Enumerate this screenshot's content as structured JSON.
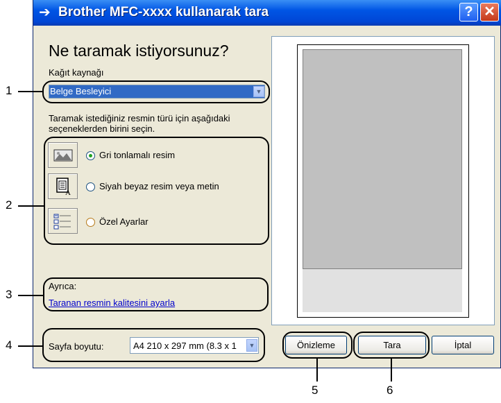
{
  "window": {
    "title": "Brother MFC-xxxx  kullanarak tara",
    "help_label": "?",
    "close_label": "✕"
  },
  "main": {
    "heading": "Ne taramak istiyorsunuz?",
    "source_label": "Kağıt kaynağı",
    "source_value": "Belge Besleyici",
    "instruction": "Taramak istediğiniz resmin türü için aşağıdaki seçeneklerden birini seçin.",
    "options": [
      {
        "label": "Gri tonlamalı resim",
        "selected": true,
        "icon": "photo-icon"
      },
      {
        "label": "Siyah beyaz resim veya metin",
        "selected": false,
        "icon": "text-document-icon"
      },
      {
        "label": "Özel Ayarlar",
        "selected": false,
        "icon": "custom-settings-icon"
      }
    ],
    "also_label": "Ayrıca:",
    "quality_link": "Taranan resmin kalitesini ayarla",
    "page_size_label": "Sayfa boyutu:",
    "page_size_value": "A4 210 x 297 mm (8.3 x 1"
  },
  "buttons": {
    "preview": "Önizleme",
    "scan": "Tara",
    "cancel": "İptal"
  },
  "callouts": [
    "1",
    "2",
    "3",
    "4",
    "5",
    "6"
  ],
  "colors": {
    "titlebar": "#0055e5",
    "dialog_bg": "#ece9d8",
    "selection": "#316ac5",
    "link": "#0000cc",
    "radio_selected": "#21a121"
  }
}
